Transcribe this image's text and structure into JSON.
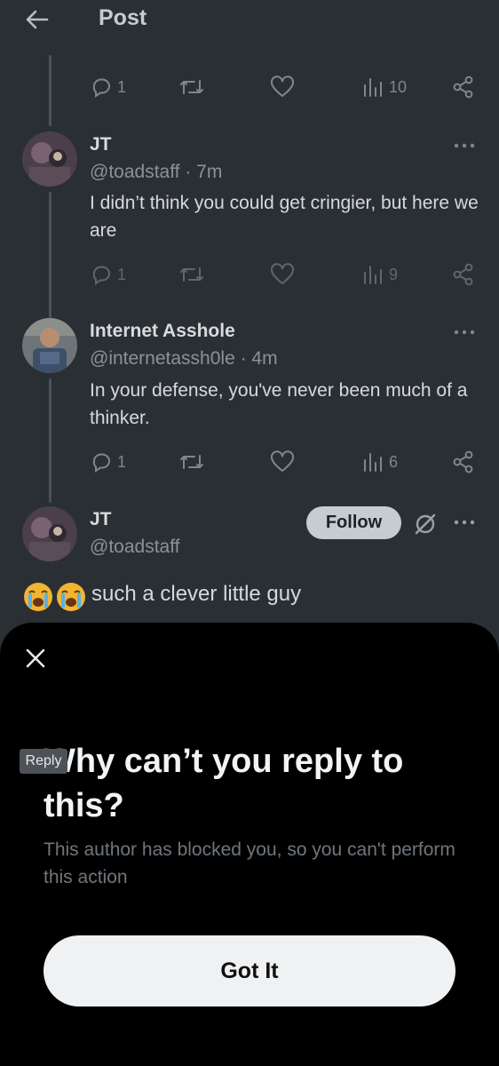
{
  "header": {
    "title": "Post"
  },
  "tweets": [
    {
      "actions": {
        "replies": "1",
        "views": "10"
      }
    },
    {
      "name": "JT",
      "handle": "@toadstaff · 7m",
      "text": "I didn’t think you could get cringier, but here we are",
      "actions": {
        "replies": "1",
        "views": "9"
      }
    },
    {
      "name": "Internet Asshole",
      "handle": "@internetassh0le · 4m",
      "text": "In your defense,  you've never been much of a thinker.",
      "actions": {
        "replies": "1",
        "views": "6"
      }
    },
    {
      "name": "JT",
      "handle": "@toadstaff",
      "follow_label": "Follow",
      "text": "such a clever little guy"
    }
  ],
  "sheet": {
    "reply_tag": "Reply",
    "title": "Why can’t you reply to this?",
    "description": "This author has blocked you, so you can't perform this action",
    "button_label": "Got It"
  },
  "colors": {
    "background": "#2a2f34",
    "sheet": "#000000",
    "icon": "#7f878d"
  }
}
